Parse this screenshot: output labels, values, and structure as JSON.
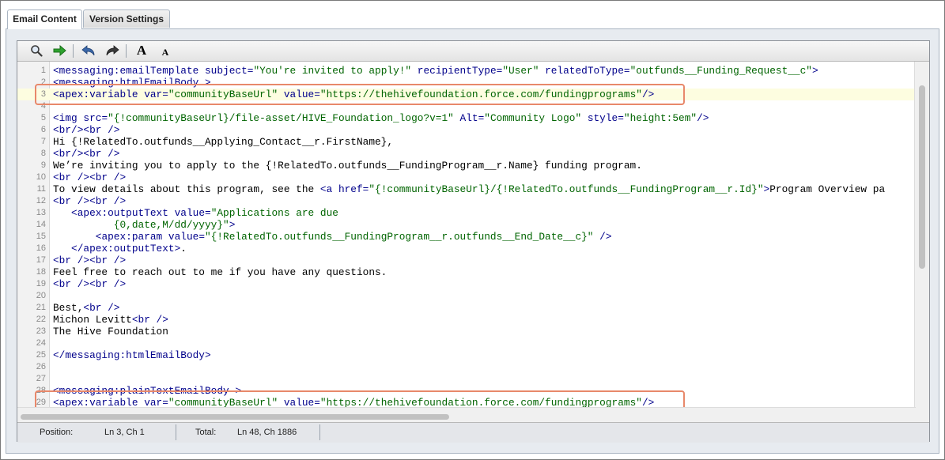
{
  "tabs": [
    {
      "label": "Email Content",
      "active": true
    },
    {
      "label": "Version Settings",
      "active": false
    }
  ],
  "toolbar": {
    "icons": [
      "search-icon",
      "go-arrow-icon",
      "undo-icon",
      "redo-icon",
      "font-increase-icon",
      "font-decrease-icon"
    ],
    "font_large_label": "A",
    "font_small_label": "A"
  },
  "editor": {
    "lines": [
      {
        "n": "1",
        "parts": [
          [
            "t",
            "<messaging:emailTemplate "
          ],
          [
            "a",
            "subject="
          ],
          [
            "s",
            "\"You're invited to apply!\""
          ],
          [
            "a",
            " recipientType="
          ],
          [
            "s",
            "\"User\""
          ],
          [
            "a",
            " relatedToType="
          ],
          [
            "s",
            "\"outfunds__Funding_Request__c\""
          ],
          [
            "t",
            ">"
          ]
        ]
      },
      {
        "n": "2",
        "parts": [
          [
            "t",
            "<messaging:htmlEmailBody >"
          ]
        ]
      },
      {
        "n": "3",
        "parts": [
          [
            "t",
            "<apex:variable "
          ],
          [
            "a",
            "var="
          ],
          [
            "s",
            "\"communityBaseUrl\""
          ],
          [
            "a",
            " value="
          ],
          [
            "s",
            "\"https://thehivefoundation.force.com/fundingprograms\""
          ],
          [
            "t",
            "/>"
          ]
        ]
      },
      {
        "n": "4",
        "parts": []
      },
      {
        "n": "5",
        "parts": [
          [
            "t",
            "<img "
          ],
          [
            "a",
            "src="
          ],
          [
            "s",
            "\"{!communityBaseUrl}/file-asset/HIVE_Foundation_logo?v=1\""
          ],
          [
            "a",
            " Alt="
          ],
          [
            "s",
            "\"Community Logo\""
          ],
          [
            "a",
            " style="
          ],
          [
            "s",
            "\"height:5em\""
          ],
          [
            "t",
            "/>"
          ]
        ]
      },
      {
        "n": "6",
        "parts": [
          [
            "t",
            "<br/><br />"
          ]
        ]
      },
      {
        "n": "7",
        "parts": [
          [
            "p",
            "Hi {!RelatedTo.outfunds__Applying_Contact__r.FirstName},"
          ]
        ]
      },
      {
        "n": "8",
        "parts": [
          [
            "t",
            "<br/><br />"
          ]
        ]
      },
      {
        "n": "9",
        "parts": [
          [
            "p",
            "We’re inviting you to apply to the {!RelatedTo.outfunds__FundingProgram__r.Name} funding program."
          ]
        ]
      },
      {
        "n": "10",
        "parts": [
          [
            "t",
            "<br /><br />"
          ]
        ]
      },
      {
        "n": "11",
        "parts": [
          [
            "p",
            "To view details about this program, see the "
          ],
          [
            "t",
            "<a "
          ],
          [
            "a",
            "href="
          ],
          [
            "s",
            "\"{!communityBaseUrl}/{!RelatedTo.outfunds__FundingProgram__r.Id}\""
          ],
          [
            "t",
            ">"
          ],
          [
            "p",
            "Program Overview pa"
          ]
        ]
      },
      {
        "n": "12",
        "parts": [
          [
            "t",
            "<br /><br />"
          ]
        ]
      },
      {
        "n": "13",
        "parts": [
          [
            "p",
            "   "
          ],
          [
            "t",
            "<apex:outputText "
          ],
          [
            "a",
            "value="
          ],
          [
            "s",
            "\"Applications are due"
          ]
        ]
      },
      {
        "n": "14",
        "parts": [
          [
            "s",
            "          {0,date,M/dd/yyyy}\""
          ],
          [
            "t",
            ">"
          ]
        ]
      },
      {
        "n": "15",
        "parts": [
          [
            "p",
            "       "
          ],
          [
            "t",
            "<apex:param "
          ],
          [
            "a",
            "value="
          ],
          [
            "s",
            "\"{!RelatedTo.outfunds__FundingProgram__r.outfunds__End_Date__c}\""
          ],
          [
            "t",
            " />"
          ]
        ]
      },
      {
        "n": "16",
        "parts": [
          [
            "p",
            "   "
          ],
          [
            "t",
            "</apex:outputText>"
          ],
          [
            "p",
            "."
          ]
        ]
      },
      {
        "n": "17",
        "parts": [
          [
            "t",
            "<br /><br />"
          ]
        ]
      },
      {
        "n": "18",
        "parts": [
          [
            "p",
            "Feel free to reach out to me if you have any questions."
          ]
        ]
      },
      {
        "n": "19",
        "parts": [
          [
            "t",
            "<br /><br />"
          ]
        ]
      },
      {
        "n": "20",
        "parts": []
      },
      {
        "n": "21",
        "parts": [
          [
            "p",
            "Best,"
          ],
          [
            "t",
            "<br />"
          ]
        ]
      },
      {
        "n": "22",
        "parts": [
          [
            "p",
            "Michon Levitt"
          ],
          [
            "t",
            "<br />"
          ]
        ]
      },
      {
        "n": "23",
        "parts": [
          [
            "p",
            "The Hive Foundation"
          ]
        ]
      },
      {
        "n": "24",
        "parts": []
      },
      {
        "n": "25",
        "parts": [
          [
            "t",
            "</messaging:htmlEmailBody>"
          ]
        ]
      },
      {
        "n": "26",
        "parts": []
      },
      {
        "n": "27",
        "parts": []
      },
      {
        "n": "28",
        "parts": [
          [
            "t",
            "<messaging:plainTextEmailBody >"
          ]
        ]
      },
      {
        "n": "29",
        "parts": [
          [
            "t",
            "<apex:variable "
          ],
          [
            "a",
            "var="
          ],
          [
            "s",
            "\"communityBaseUrl\""
          ],
          [
            "a",
            " value="
          ],
          [
            "s",
            "\"https://thehivefoundation.force.com/fundingprograms\""
          ],
          [
            "t",
            "/>"
          ]
        ]
      }
    ],
    "highlighted_line": "3"
  },
  "statusbar": {
    "position_label": "Position:",
    "position_value": "Ln 3, Ch 1",
    "total_label": "Total:",
    "total_value": "Ln 48, Ch 1886"
  }
}
